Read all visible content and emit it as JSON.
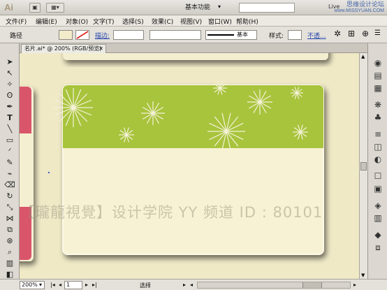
{
  "titlebar": {
    "app_logo": "Ai",
    "workspace": "基本功能",
    "live": "Live",
    "watermark_line1": "思缘设计论坛",
    "watermark_line2": "www.MISSYUAN.COM"
  },
  "menu": [
    "文件(F)",
    "编辑(E)",
    "对象(O)",
    "文字(T)",
    "选择(S)",
    "效果(C)",
    "视图(V)",
    "窗口(W)",
    "帮助(H)"
  ],
  "control": {
    "selection_label": "路径",
    "stroke_label": "描边:",
    "style_label": "基本",
    "brush_label": "样式:",
    "opacity_label": "不透..."
  },
  "document": {
    "tab_title": "名片.ai* @ 200% (RGB/预览)"
  },
  "canvas": {
    "watermark": "【瓏龍視覺】设计学院  YY 频道 ID : 80101"
  },
  "status": {
    "zoom": "200%",
    "page": "1",
    "tool": "选择"
  },
  "colors": {
    "card_green": "#a8c43d",
    "card_cream": "#f7f2d3",
    "pink": "#d9556a",
    "canvas_bg": "#f0ebc8"
  }
}
